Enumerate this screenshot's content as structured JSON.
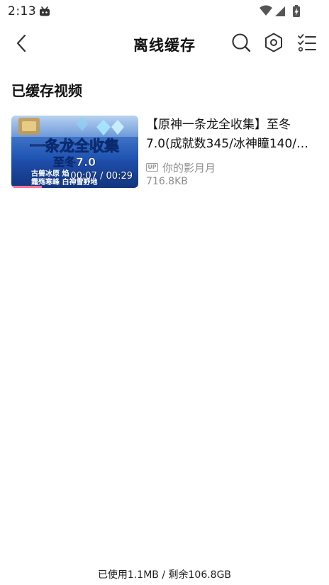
{
  "status_bar": {
    "time": "2:13",
    "app_icon": "bilibili-tv-icon",
    "icons": [
      "wifi-icon",
      "cell-signal-icon",
      "battery-icon"
    ]
  },
  "nav": {
    "title": "离线缓存",
    "back_icon": "back-arrow-icon",
    "search_icon": "search-icon",
    "settings_icon": "hexagon-settings-icon",
    "edit_icon": "checklist-icon"
  },
  "section": {
    "title": "已缓存视频"
  },
  "videos": [
    {
      "title_line1": "【原神一条龙全收集】至冬",
      "title_line2": "7.0(成就数345/冰神瞳140/…",
      "duration": "00:07 / 00:29",
      "up_badge": "UP",
      "uploader": "你的影月月",
      "size": "716.8KB",
      "progress": 0.24,
      "thumbnail": {
        "headline": "一条龙全收集",
        "subheadline": "至冬7.0",
        "tag_row1": "古兽冰原 焰",
        "tag_row2": "霜殇寒峰 白神雪野地"
      }
    }
  ],
  "footer": {
    "storage": "已使用1.1MB / 剩余106.8GB"
  },
  "colors": {
    "accent_pink": "#fb7299",
    "thumb_blue": "#1e56b4",
    "text_secondary": "#8e8e8e"
  }
}
